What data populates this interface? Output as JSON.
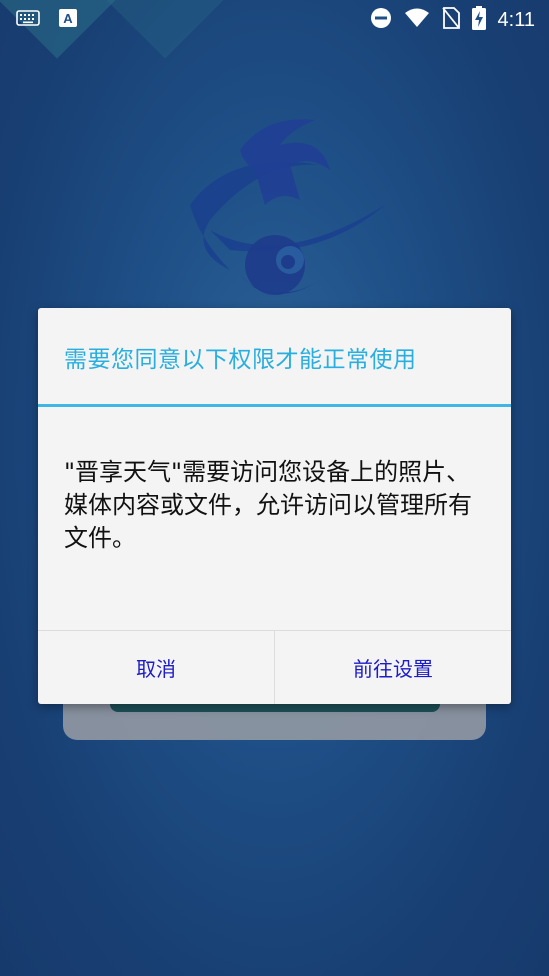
{
  "status_bar": {
    "time": "4:11",
    "icons": [
      "keyboard-icon",
      "app-notification-icon",
      "do-not-disturb-icon",
      "wifi-icon",
      "no-sim-icon",
      "battery-charging-icon"
    ]
  },
  "dialog": {
    "title": "需要您同意以下权限才能正常使用",
    "message": "\"晋享天气\"需要访问您设备上的照片、媒体内容或文件，允许访问以管理所有文件。",
    "cancel_label": "取消",
    "settings_label": "前往设置"
  },
  "colors": {
    "background": "#1e4f86",
    "title": "#29aee0",
    "button_text": "#1c1cc8",
    "divider_accent": "#3fb6e6"
  }
}
